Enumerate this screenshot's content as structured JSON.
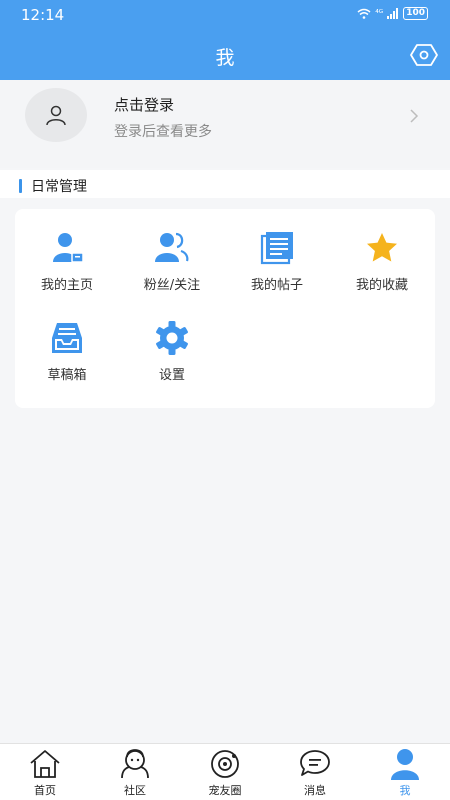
{
  "status_bar": {
    "time": "12:14",
    "signal": "⁴ᴳ",
    "battery": "100"
  },
  "header": {
    "title": "我"
  },
  "profile": {
    "title": "点击登录",
    "subtitle": "登录后查看更多"
  },
  "section": {
    "title": "日常管理"
  },
  "grid": [
    {
      "label": "我的主页",
      "icon": "user-home-icon"
    },
    {
      "label": "粉丝/关注",
      "icon": "users-icon"
    },
    {
      "label": "我的帖子",
      "icon": "document-icon"
    },
    {
      "label": "我的收藏",
      "icon": "star-icon"
    },
    {
      "label": "草稿箱",
      "icon": "inbox-icon"
    },
    {
      "label": "设置",
      "icon": "gear-icon"
    }
  ],
  "tabs": [
    {
      "label": "首页",
      "icon": "home-icon"
    },
    {
      "label": "社区",
      "icon": "community-icon"
    },
    {
      "label": "宠友圈",
      "icon": "pet-circle-icon"
    },
    {
      "label": "消息",
      "icon": "message-icon"
    },
    {
      "label": "我",
      "icon": "profile-icon"
    }
  ],
  "colors": {
    "primary": "#4a9ff0",
    "icon_blue": "#3f95ec",
    "star": "#f5b31d"
  }
}
